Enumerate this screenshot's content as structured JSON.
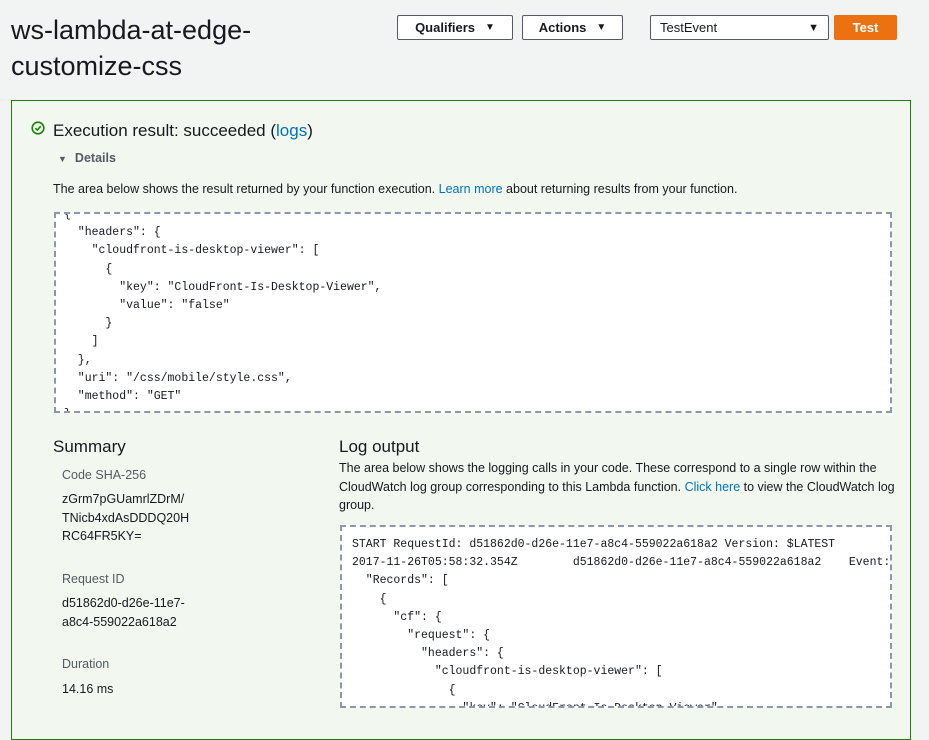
{
  "header": {
    "function_title": "ws-lambda-at-edge-customize-css",
    "qualifiers_label": "Qualifiers",
    "actions_label": "Actions",
    "test_event_value": "TestEvent",
    "test_label": "Test"
  },
  "result": {
    "title_prefix": "Execution result: succeeded (",
    "logs_link": "logs",
    "title_suffix": ")",
    "details_label": "Details",
    "desc_before": "The area below shows the result returned by your function execution. ",
    "learn_more": "Learn more",
    "desc_after": " about returning results from your function.",
    "json_output": "{\n  \"headers\": {\n    \"cloudfront-is-desktop-viewer\": [\n      {\n        \"key\": \"CloudFront-Is-Desktop-Viewer\",\n        \"value\": \"false\"\n      }\n    ]\n  },\n  \"uri\": \"/css/mobile/style.css\",\n  \"method\": \"GET\"\n}"
  },
  "summary": {
    "heading": "Summary",
    "code_sha_label": "Code SHA-256",
    "code_sha_value": "zGrm7pGUamrlZDrM/\nTNicb4xdAsDDDQ20H\nRC64FR5KY=",
    "request_id_label": "Request ID",
    "request_id_value": "d51862d0-d26e-11e7-\na8c4-559022a618a2",
    "duration_label": "Duration",
    "duration_value": "14.16 ms"
  },
  "log": {
    "heading": "Log output",
    "desc_before": "The area below shows the logging calls in your code. These correspond to a single row within the CloudWatch log group corresponding to this Lambda function. ",
    "click_here": "Click here",
    "desc_after": " to view the CloudWatch log group.",
    "output": "START RequestId: d51862d0-d26e-11e7-a8c4-559022a618a2 Version: $LATEST\n2017-11-26T05:58:32.354Z        d51862d0-d26e-11e7-a8c4-559022a618a2    Event: {\n  \"Records\": [\n    {\n      \"cf\": {\n        \"request\": {\n          \"headers\": {\n            \"cloudfront-is-desktop-viewer\": [\n              {\n                \"key\": \"CloudFront-Is-Desktop-Viewer\","
  },
  "colors": {
    "accent": "#ec7211",
    "success": "#1d8102",
    "link": "#0073bb"
  },
  "icons": [
    "check-circle-icon",
    "caret-down-icon",
    "triangle-down-icon"
  ]
}
